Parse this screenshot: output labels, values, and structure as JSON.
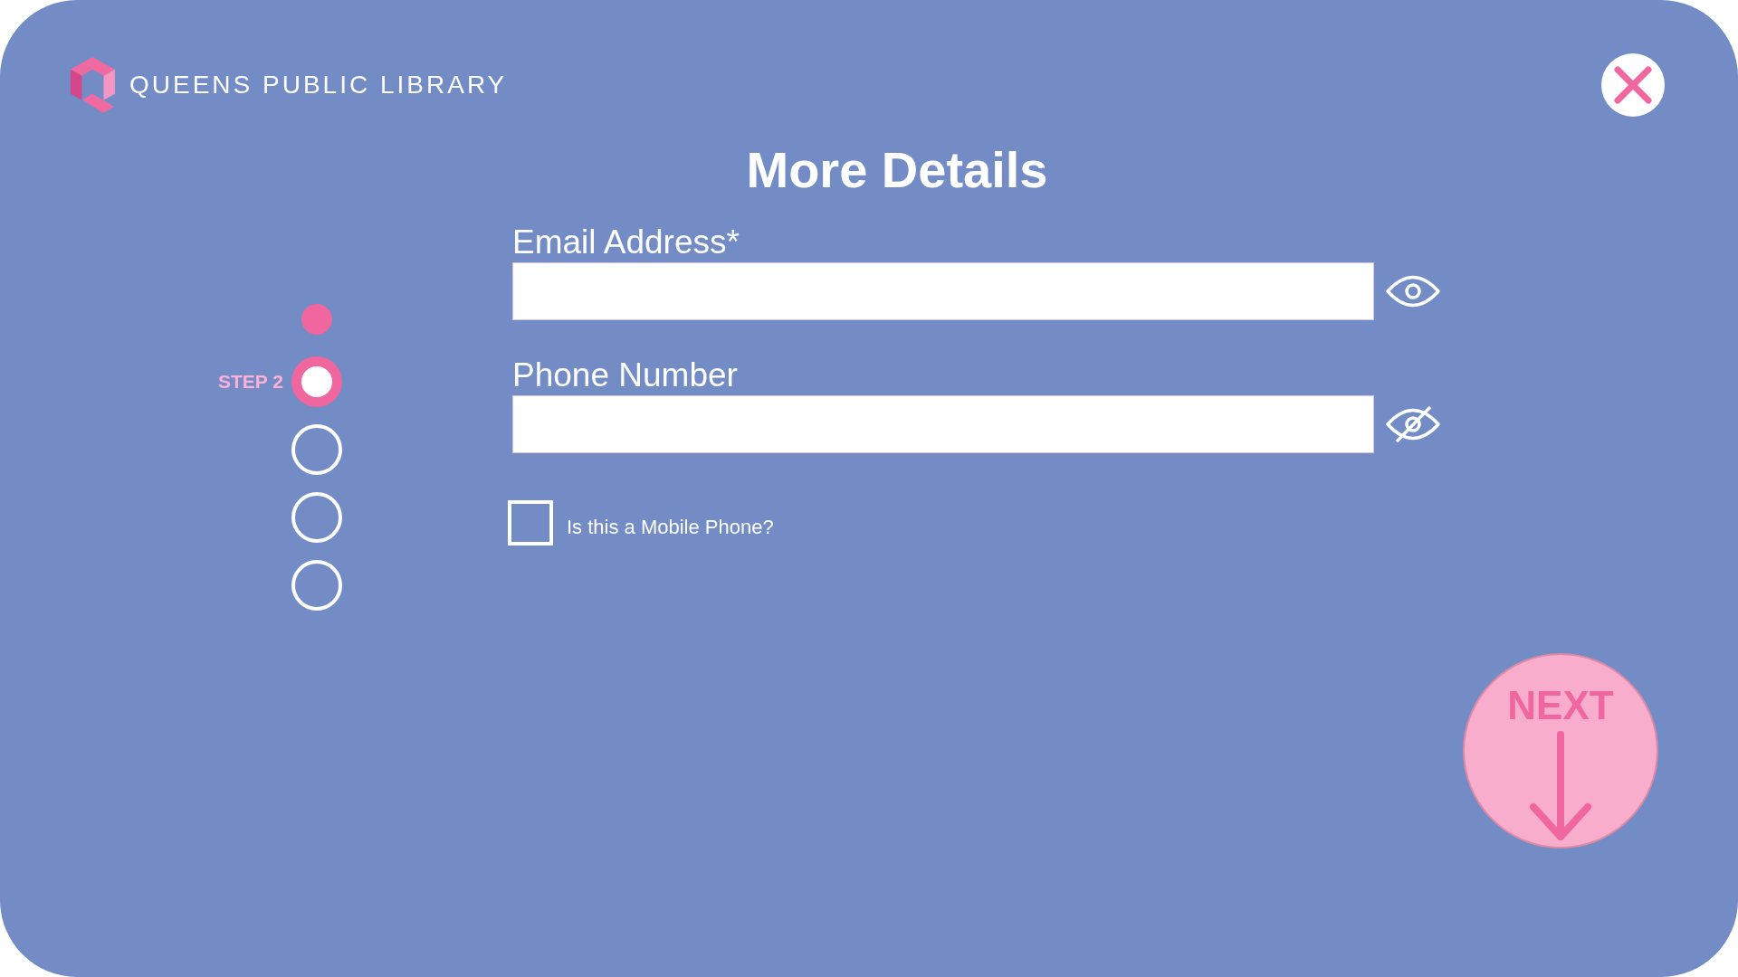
{
  "header": {
    "brand": "QUEENS PUBLIC LIBRARY"
  },
  "title": "More Details",
  "steps": [
    {
      "completed": true,
      "selected": false
    },
    {
      "label": "STEP 2",
      "completed": false,
      "selected": true
    },
    {
      "completed": false,
      "selected": false
    },
    {
      "completed": false,
      "selected": false
    },
    {
      "completed": false,
      "selected": false
    }
  ],
  "fields": [
    {
      "label": "Email Address*",
      "visible": true
    },
    {
      "label": "Phone Number",
      "visible": false
    }
  ],
  "checkbox": {
    "label": "Is this a Mobile Phone?",
    "checked": false
  },
  "next_button": {
    "label": "NEXT"
  }
}
